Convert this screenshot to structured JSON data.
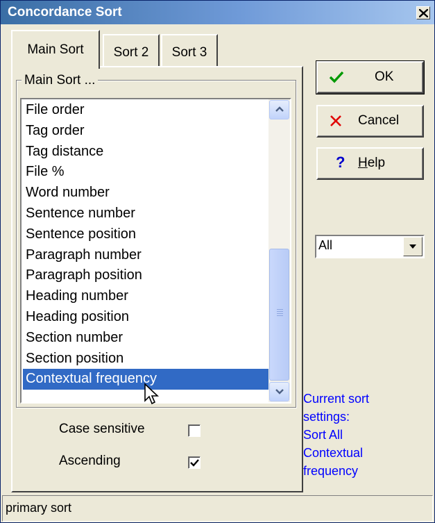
{
  "window": {
    "title": "Concordance Sort"
  },
  "tabs": [
    {
      "label": "Main Sort",
      "active": true
    },
    {
      "label": "Sort 2",
      "active": false
    },
    {
      "label": "Sort 3",
      "active": false
    }
  ],
  "group": {
    "label": "Main Sort ..."
  },
  "list": {
    "items": [
      "File order",
      "Tag order",
      "Tag distance",
      "File %",
      "Word number",
      "Sentence number",
      "Sentence position",
      "Paragraph number",
      "Paragraph position",
      "Heading number",
      "Heading position",
      "Section number",
      "Section position",
      "Contextual frequency"
    ],
    "selected": "Contextual frequency"
  },
  "options": {
    "case_sensitive": {
      "label": "Case sensitive",
      "checked": false
    },
    "ascending": {
      "label": "Ascending",
      "checked": true
    }
  },
  "buttons": {
    "ok": {
      "label": "OK",
      "icon": "checkmark-icon"
    },
    "cancel": {
      "label": "Cancel",
      "icon": "x-icon"
    },
    "help": {
      "label": "Help",
      "icon": "question-icon"
    }
  },
  "combo": {
    "value": "All"
  },
  "sort_info": {
    "lines": [
      "Current sort",
      "settings:",
      "Sort All",
      "Contextual",
      "frequency"
    ]
  },
  "status": {
    "text": "primary sort"
  },
  "colors": {
    "selection": "#316AC5",
    "info_text": "#0000FF",
    "dialog_bg": "#ECE9D8"
  }
}
